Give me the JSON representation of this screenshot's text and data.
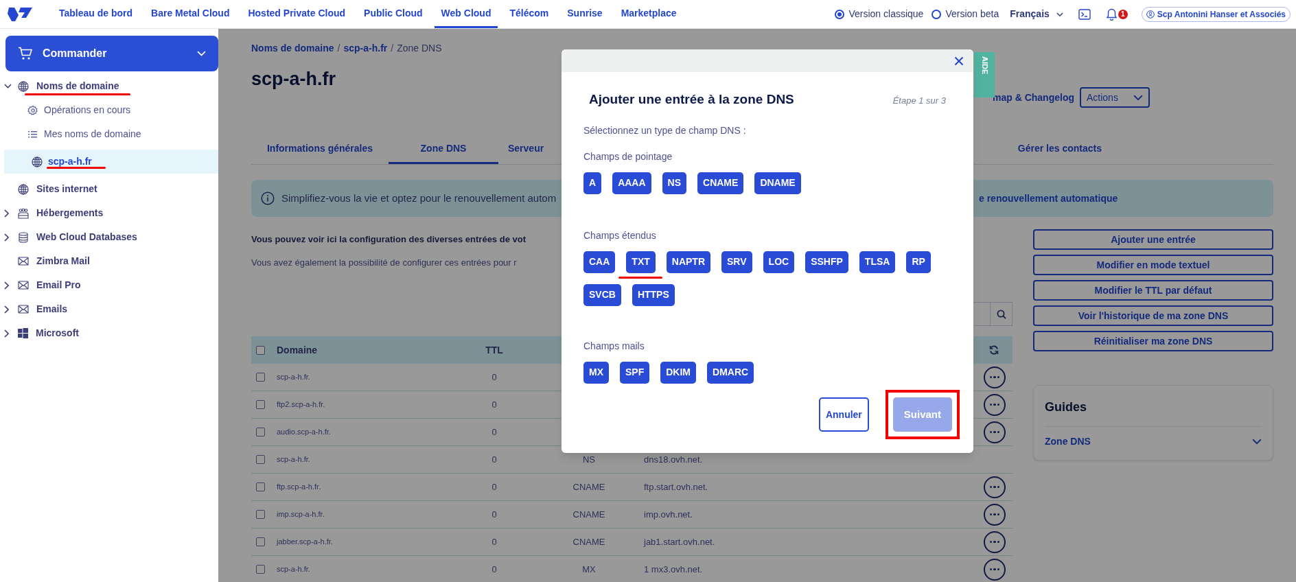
{
  "topnav": {
    "items": [
      {
        "label": "Tableau de bord",
        "selected": false
      },
      {
        "label": "Bare Metal Cloud",
        "selected": false
      },
      {
        "label": "Hosted Private Cloud",
        "selected": false
      },
      {
        "label": "Public Cloud",
        "selected": false
      },
      {
        "label": "Web Cloud",
        "selected": true
      },
      {
        "label": "Télécom",
        "selected": false
      },
      {
        "label": "Sunrise",
        "selected": false
      },
      {
        "label": "Marketplace",
        "selected": false
      }
    ],
    "version_options": [
      {
        "label": "Version classique",
        "selected": true
      },
      {
        "label": "Version beta",
        "selected": false
      }
    ],
    "language": "Français",
    "notification_count": "1",
    "user": "Scp Antonini Hanser et Associés"
  },
  "sidebar": {
    "order_button": "Commander",
    "items": [
      {
        "label": "Noms de domaine",
        "expandable": true,
        "expanded": true,
        "underlined": true,
        "children": [
          {
            "label": "Opérations en cours",
            "selected": false,
            "underlined": false
          },
          {
            "label": "Mes noms de domaine",
            "selected": false,
            "underlined": false
          },
          {
            "label": "scp-a-h.fr",
            "selected": true,
            "underlined": true
          }
        ]
      },
      {
        "label": "Sites internet",
        "expandable": false,
        "underlined": false
      },
      {
        "label": "Hébergements",
        "expandable": true,
        "expanded": false,
        "underlined": false
      },
      {
        "label": "Web Cloud Databases",
        "expandable": true,
        "expanded": false,
        "underlined": false
      },
      {
        "label": "Zimbra Mail",
        "expandable": false,
        "underlined": false
      },
      {
        "label": "Email Pro",
        "expandable": true,
        "expanded": false,
        "underlined": false
      },
      {
        "label": "Emails",
        "expandable": true,
        "expanded": false,
        "underlined": false
      },
      {
        "label": "Microsoft",
        "expandable": true,
        "expanded": false,
        "underlined": false
      }
    ]
  },
  "page": {
    "breadcrumb": [
      {
        "label": "Noms de domaine",
        "kind": "link",
        "separator": "/"
      },
      {
        "label": "scp-a-h.fr",
        "kind": "link",
        "separator": "/"
      },
      {
        "label": "Zone DNS",
        "kind": "current"
      }
    ],
    "title": "scp-a-h.fr",
    "roadmap_link": "map & Changelog",
    "actions_button": "Actions",
    "help_tab": "AIDE",
    "tabs": [
      {
        "label": "Informations générales",
        "selected": false
      },
      {
        "label": "Zone DNS",
        "selected": true
      },
      {
        "label": "Serveur",
        "selected": false
      },
      {
        "label": "Gérer les contacts",
        "selected": false
      }
    ],
    "banner": {
      "text_left": "Simplifiez-vous la vie et optez pour le renouvellement autom",
      "text_right": "e renouvellement automatique"
    },
    "intro": "Vous pouvez voir ici la configuration des diverses entrées de vot",
    "note": "Vous avez également la possibilité de configurer ces entrées pour r"
  },
  "table": {
    "columns": [
      "Domaine",
      "TTL"
    ],
    "all_checked": false,
    "rows": [
      {
        "domain": "scp-a-h.fr.",
        "ttl": "0",
        "has_actions": true,
        "checked": false
      },
      {
        "domain": "ftp2.scp-a-h.fr.",
        "ttl": "0",
        "has_actions": true,
        "checked": false
      },
      {
        "domain": "audio.scp-a-h.fr.",
        "ttl": "0",
        "has_actions": true,
        "checked": false
      },
      {
        "domain": "scp-a-h.fr.",
        "ttl": "0",
        "type": "NS",
        "target": "dns18.ovh.net.",
        "has_actions": false,
        "checked": false
      },
      {
        "domain": "ftp.scp-a-h.fr.",
        "ttl": "0",
        "type": "CNAME",
        "target": "ftp.start.ovh.net.",
        "has_actions": true,
        "checked": false
      },
      {
        "domain": "imp.scp-a-h.fr.",
        "ttl": "0",
        "type": "CNAME",
        "target": "imp.ovh.net.",
        "has_actions": true,
        "checked": false
      },
      {
        "domain": "jabber.scp-a-h.fr.",
        "ttl": "0",
        "type": "CNAME",
        "target": "jab1.start.ovh.net.",
        "has_actions": true,
        "checked": false
      },
      {
        "domain": "scp-a-h.fr.",
        "ttl": "0",
        "type": "MX",
        "target": "1 mx3.ovh.net.",
        "has_actions": true,
        "checked": false
      }
    ]
  },
  "side_actions": [
    "Ajouter une entrée",
    "Modifier en mode textuel",
    "Modifier le TTL par défaut",
    "Voir l'historique de ma zone DNS",
    "Réinitialiser ma zone DNS"
  ],
  "guides": {
    "title": "Guides",
    "items": [
      {
        "label": "Zone DNS",
        "expanded": false
      }
    ]
  },
  "modal": {
    "title": "Ajouter une entrée à la zone DNS",
    "step": "Étape 1 sur 3",
    "prompt": "Sélectionnez un type de champ DNS :",
    "groups": [
      {
        "label": "Champs de pointage",
        "types": [
          {
            "label": "A",
            "underlined": false
          },
          {
            "label": "AAAA",
            "underlined": false
          },
          {
            "label": "NS",
            "underlined": false
          },
          {
            "label": "CNAME",
            "underlined": false
          },
          {
            "label": "DNAME",
            "underlined": false
          }
        ]
      },
      {
        "label": "Champs étendus",
        "types": [
          {
            "label": "CAA",
            "underlined": false
          },
          {
            "label": "TXT",
            "underlined": true
          },
          {
            "label": "NAPTR",
            "underlined": false
          },
          {
            "label": "SRV",
            "underlined": false
          },
          {
            "label": "LOC",
            "underlined": false
          },
          {
            "label": "SSHFP",
            "underlined": false
          },
          {
            "label": "TLSA",
            "underlined": false
          },
          {
            "label": "RP",
            "underlined": false
          },
          {
            "label": "SVCB",
            "underlined": false
          },
          {
            "label": "HTTPS",
            "underlined": false
          }
        ]
      },
      {
        "label": "Champs mails",
        "types": [
          {
            "label": "MX",
            "underlined": false
          },
          {
            "label": "SPF",
            "underlined": false
          },
          {
            "label": "DKIM",
            "underlined": false
          },
          {
            "label": "DMARC",
            "underlined": false
          }
        ]
      }
    ],
    "buttons": [
      {
        "label": "Annuler",
        "kind": "secondary",
        "disabled": false,
        "boxed": false
      },
      {
        "label": "Suivant",
        "kind": "primary",
        "disabled": true,
        "boxed": true
      }
    ]
  }
}
